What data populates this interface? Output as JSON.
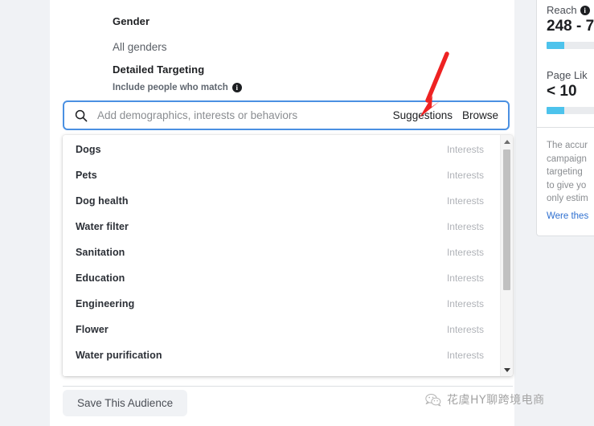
{
  "form": {
    "gender": {
      "label": "Gender",
      "value": "All genders"
    },
    "detailed_targeting": {
      "label": "Detailed Targeting",
      "sub_label": "Include people who match",
      "info_glyph": "i"
    },
    "search": {
      "placeholder": "Add demographics, interests or behaviors",
      "value": "",
      "suggestions_label": "Suggestions",
      "browse_label": "Browse"
    },
    "save_button": "Save This Audience"
  },
  "suggestions": [
    {
      "name": "Dogs",
      "category": "Interests"
    },
    {
      "name": "Pets",
      "category": "Interests"
    },
    {
      "name": "Dog health",
      "category": "Interests"
    },
    {
      "name": "Water filter",
      "category": "Interests"
    },
    {
      "name": "Sanitation",
      "category": "Interests"
    },
    {
      "name": "Education",
      "category": "Interests"
    },
    {
      "name": "Engineering",
      "category": "Interests"
    },
    {
      "name": "Flower",
      "category": "Interests"
    },
    {
      "name": "Water purification",
      "category": "Interests"
    }
  ],
  "sidebar": {
    "reach": {
      "title": "Reach",
      "value": "248 - 7",
      "bar_percent": 28
    },
    "page_likes": {
      "title": "Page Lik",
      "value": "< 10",
      "bar_percent": 28
    },
    "note_lines": [
      "The accur",
      "campaign",
      "targeting",
      "to give yo",
      "only estim"
    ],
    "note_link": "Were thes"
  },
  "annotation": {
    "arrow_color": "#ee2222"
  },
  "watermark": {
    "text": "花虞HY聊跨境电商",
    "icon": "wechat-icon"
  },
  "colors": {
    "accent_blue": "#4a90e2",
    "bar_cyan": "#4dc3ec",
    "link_blue": "#2d6fd0",
    "page_bg": "#f0f2f5"
  }
}
